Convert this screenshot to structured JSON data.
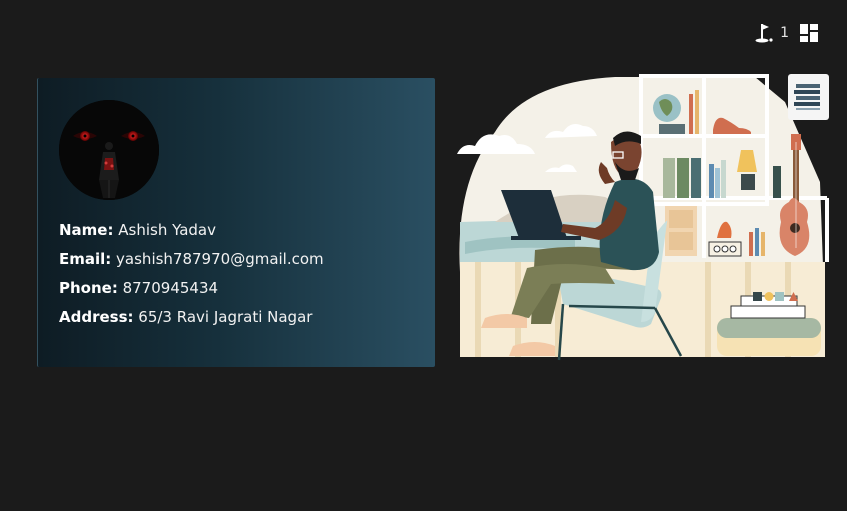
{
  "toolbar": {
    "flag_icon": "golf-flag-icon",
    "count": "1",
    "dashboard_icon": "dashboard-layout-icon"
  },
  "profile": {
    "avatar": "avatar-image",
    "fields": [
      {
        "label": "Name:",
        "value": " Ashish Yadav"
      },
      {
        "label": "Email:",
        "value": " yashish787970@gmail.com"
      },
      {
        "label": "Phone:",
        "value": " 8770945434"
      },
      {
        "label": "Address:",
        "value": " 65/3 Ravi Jagrati Nagar"
      }
    ]
  },
  "illustration": {
    "name": "person-working-on-laptop-illustration"
  },
  "side_thumbnail": {
    "icon": "document-thumbnail-icon"
  },
  "colors": {
    "background": "#1b1b1b",
    "card_gradient_start": "#0e1c24",
    "card_gradient_end": "#2a4f62",
    "text": "#f2f2f2"
  }
}
